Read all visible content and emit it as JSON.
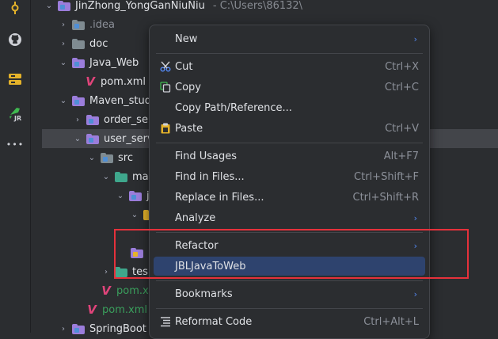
{
  "activity_bar": {
    "icons": [
      "commit-icon",
      "github-icon",
      "database-tool-icon",
      "jrebel-icon",
      "more-icon"
    ],
    "jr_label": "JR",
    "more_label": "•••"
  },
  "tree": {
    "root": {
      "name": "JinZhong_YongGanNiuNiu",
      "path": "- C:\\Users\\86132\\"
    },
    "idea": ".idea",
    "doc": "doc",
    "java_web": "Java_Web",
    "pom1": "pom.xml",
    "maven_studio": "Maven_studi",
    "order_ser": "order_ser",
    "user_serv": "user_serv",
    "src": "src",
    "main": "mai",
    "java": "j",
    "r_item": "r",
    "test": "tes",
    "pom2": "pom.x",
    "pom3": "pom.xml",
    "springboot": "SpringBoot"
  },
  "menu": {
    "items": [
      {
        "label": "New",
        "shortcut": "",
        "submenu": true,
        "icon": ""
      },
      {
        "label": "Cut",
        "shortcut": "Ctrl+X",
        "submenu": false,
        "icon": "cut-icon"
      },
      {
        "label": "Copy",
        "shortcut": "Ctrl+C",
        "submenu": false,
        "icon": "copy-icon"
      },
      {
        "label": "Copy Path/Reference...",
        "shortcut": "",
        "submenu": false,
        "icon": ""
      },
      {
        "label": "Paste",
        "shortcut": "Ctrl+V",
        "submenu": false,
        "icon": "paste-icon"
      },
      {
        "label": "Find Usages",
        "shortcut": "Alt+F7",
        "submenu": false,
        "icon": ""
      },
      {
        "label": "Find in Files...",
        "shortcut": "Ctrl+Shift+F",
        "submenu": false,
        "icon": ""
      },
      {
        "label": "Replace in Files...",
        "shortcut": "Ctrl+Shift+R",
        "submenu": false,
        "icon": ""
      },
      {
        "label": "Analyze",
        "shortcut": "",
        "submenu": true,
        "icon": ""
      },
      {
        "label": "Refactor",
        "shortcut": "",
        "submenu": true,
        "icon": ""
      },
      {
        "label": "JBLJavaToWeb",
        "shortcut": "",
        "submenu": false,
        "icon": ""
      },
      {
        "label": "Bookmarks",
        "shortcut": "",
        "submenu": true,
        "icon": ""
      },
      {
        "label": "Reformat Code",
        "shortcut": "Ctrl+Alt+L",
        "submenu": false,
        "icon": "reformat-icon"
      }
    ],
    "highlighted": "JBLJavaToWeb",
    "submenu_glyph": "›"
  },
  "colors": {
    "accent": "#2e436e",
    "highlight_box": "#e5313b",
    "module_folder": "#9b7ddb",
    "resource_folder": "#3fa78c",
    "source_folder": "#4f8fd6",
    "maven_v": "#e0447a"
  }
}
